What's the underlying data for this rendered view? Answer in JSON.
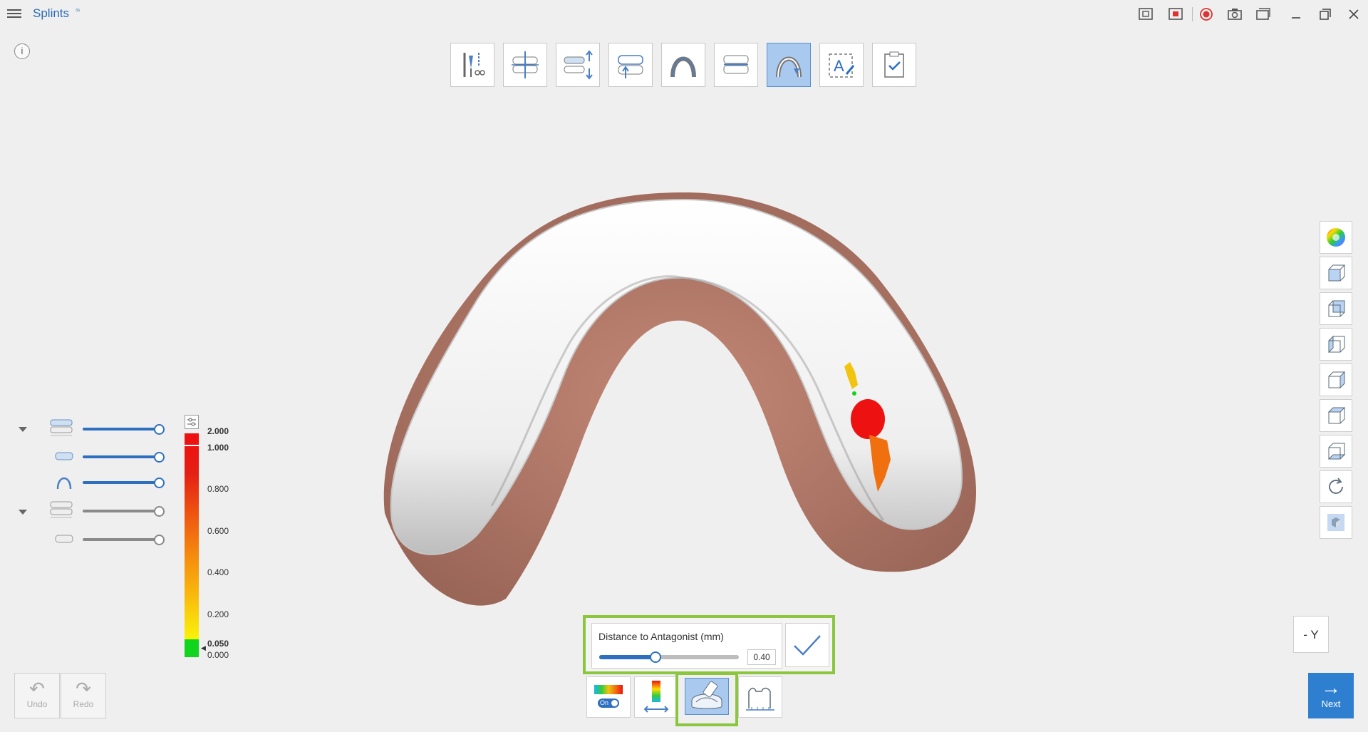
{
  "app": {
    "title": "Splints",
    "mark": "⁵⁵"
  },
  "titlebar_icons": [
    "capture-icon",
    "screen-record-area-icon",
    "record-icon",
    "camera-icon",
    "gallery-icon",
    "minimize-icon",
    "restore-icon",
    "close-icon"
  ],
  "info_label": "i",
  "steps": [
    {
      "name": "trim-tool-step",
      "active": false
    },
    {
      "name": "insertion-axis-step",
      "active": false
    },
    {
      "name": "occlusion-adjust-step",
      "active": false
    },
    {
      "name": "block-out-step",
      "active": false
    },
    {
      "name": "splint-outline-step",
      "active": false
    },
    {
      "name": "thickness-step",
      "active": false
    },
    {
      "name": "antagonist-step",
      "active": true
    },
    {
      "name": "text-label-step",
      "active": false
    },
    {
      "name": "finish-step",
      "active": false
    }
  ],
  "view_buttons": [
    "color-wheel-icon",
    "front-view-icon",
    "back-view-icon",
    "left-view-icon",
    "right-view-icon",
    "top-view-icon",
    "bottom-view-icon",
    "rotate-icon",
    "solid-cube-icon"
  ],
  "layers": [
    {
      "name": "upper-group",
      "expanded": true,
      "color": "blue"
    },
    {
      "name": "splint",
      "color": "blue"
    },
    {
      "name": "arch",
      "color": "blue"
    },
    {
      "name": "lower-group",
      "expanded": true,
      "color": "grey"
    },
    {
      "name": "lower-model",
      "color": "grey"
    }
  ],
  "color_scale": {
    "labels": [
      "2.000",
      "1.000",
      "0.800",
      "0.600",
      "0.400",
      "0.200",
      "0.050",
      "0.000"
    ],
    "colors": {
      "max": "#ee1111",
      "min": "#10d41d"
    }
  },
  "undo": {
    "label": "Undo"
  },
  "redo": {
    "label": "Redo"
  },
  "distance": {
    "label": "Distance to Antagonist (mm)",
    "value": "0.40",
    "fraction": 0.4
  },
  "bottom_tools": [
    {
      "name": "color-map-toggle",
      "toggle_label": "On"
    },
    {
      "name": "color-range-tool"
    },
    {
      "name": "adjust-antagonist-tool"
    },
    {
      "name": "measure-tool"
    }
  ],
  "axis_label": "- Y",
  "next": {
    "label": "Next"
  }
}
